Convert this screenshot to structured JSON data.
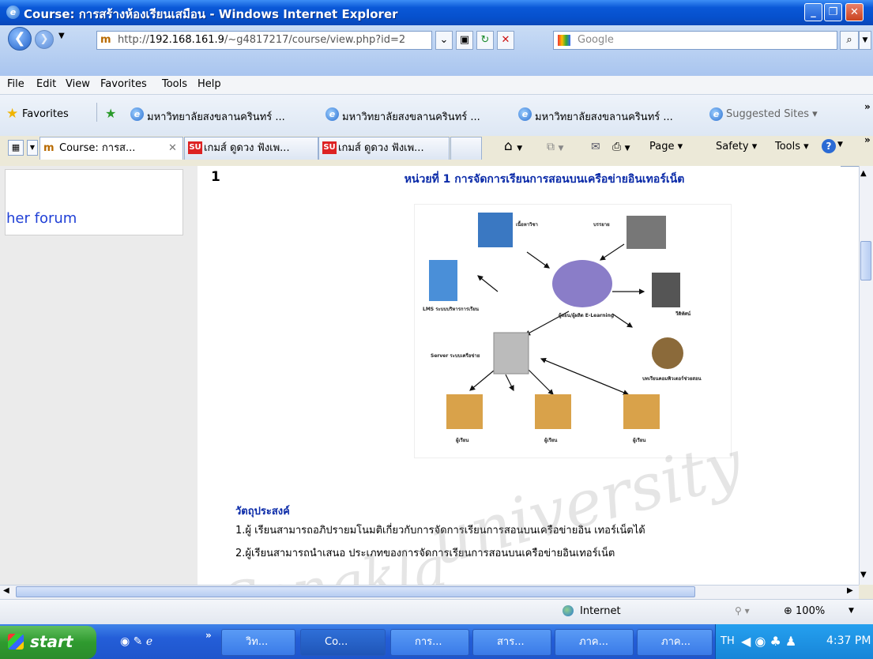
{
  "window": {
    "title": "Course: การสร้างห้องเรียนเสมือน - Windows Internet Explorer"
  },
  "address": {
    "url_prefix": "http://",
    "url_host": "192.168.161.9",
    "url_path": "/~g4817217/course/view.php?id=2",
    "search_placeholder": "Google"
  },
  "menu": [
    "File",
    "Edit",
    "View",
    "Favorites",
    "Tools",
    "Help"
  ],
  "favorites": {
    "label": "Favorites",
    "links": [
      "มหาวิทยาลัยสงขลานครินทร์ ...",
      "มหาวิทยาลัยสงขลานครินทร์ ...",
      "มหาวิทยาลัยสงขลานครินทร์ ..."
    ],
    "suggested": "Suggested Sites"
  },
  "tabs": [
    "Course: การส...",
    "เกมส์ ดูดวง ฟังเพ...",
    "เกมส์ ดูดวง ฟังเพ..."
  ],
  "commands": {
    "page": "Page",
    "safety": "Safety",
    "tools": "Tools"
  },
  "sidebar": {
    "forum_link": "her forum"
  },
  "section": {
    "number": "1",
    "title": "หน่วยที่ 1 การจัดการเรียนการสอนบนเครือข่ายอินเทอร์เน็ต",
    "objectives_heading": "วัตถุประสงค์",
    "objectives": [
      "1.ผู้ เรียนสามารถอภิปรายมโนมติเกี่ยวกับการจัดการเรียนการสอนบนเครือข่ายอิน เทอร์เน็ตได้",
      "2.ผู้เรียนสามารถนำเสนอ ประเภทของการจัดการเรียนการสอนบนเครือข่ายอินเทอร์เน็ต"
    ]
  },
  "diagram": {
    "labels": [
      "เนื้อหาวิชา",
      "บรรยาย",
      "LMS ระบบบริหารการเรียน",
      "วีดิทัศน์",
      "ผู้สอน/ผู้ผลิต E-Learning",
      "Server ระบบเครือข่าย",
      "บทเรียนคอมพิวเตอร์ช่วยสอน",
      "ผู้เรียน",
      "ผู้เรียน",
      "ผู้เรียน"
    ]
  },
  "status": {
    "zone": "Internet",
    "zoom": "100%"
  },
  "taskbar": {
    "start": "start",
    "buttons": [
      "วิท...",
      "Co...",
      "การ...",
      "สาร...",
      "ภาค...",
      "ภาค..."
    ],
    "lang": "TH",
    "clock": "4:37 PM"
  },
  "watermark": [
    "university",
    "Songkla"
  ]
}
